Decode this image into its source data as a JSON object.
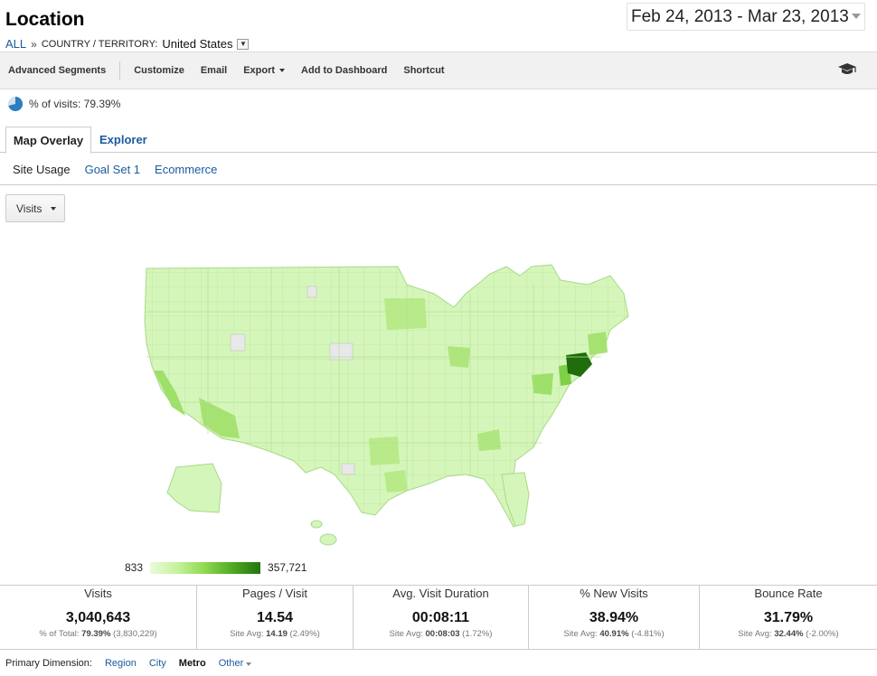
{
  "header": {
    "title": "Location",
    "breadcrumb_all": "ALL",
    "breadcrumb_sep": "»",
    "dimension_label": "COUNTRY / TERRITORY:",
    "dimension_value": "United States",
    "date_range": "Feb 24, 2013 - Mar 23, 2013"
  },
  "toolbar": {
    "items": [
      "Advanced Segments",
      "Customize",
      "Email",
      "Export",
      "Add to Dashboard",
      "Shortcut"
    ],
    "icon": "graduation-cap-icon"
  },
  "visits_pct": "% of visits: 79.39%",
  "tabs": {
    "active": "Map Overlay",
    "other": "Explorer"
  },
  "subtabs": [
    "Site Usage",
    "Goal Set 1",
    "Ecommerce"
  ],
  "metric_select": "Visits",
  "map_legend": {
    "min": "833",
    "max": "357,721",
    "colors": [
      "#e8fbd9",
      "#c5f39c",
      "#8ed84e",
      "#4fa923",
      "#237410"
    ]
  },
  "stats": [
    {
      "label": "Visits",
      "value": "3,040,643",
      "sub_prefix": "% of Total: ",
      "sub_bold": "79.39%",
      "sub_rest": " (3,830,229)"
    },
    {
      "label": "Pages / Visit",
      "value": "14.54",
      "sub_prefix": "Site Avg: ",
      "sub_bold": "14.19",
      "sub_rest": " (2.49%)"
    },
    {
      "label": "Avg. Visit Duration",
      "value": "00:08:11",
      "sub_prefix": "Site Avg: ",
      "sub_bold": "00:08:03",
      "sub_rest": " (1.72%)"
    },
    {
      "label": "% New Visits",
      "value": "38.94%",
      "sub_prefix": "Site Avg: ",
      "sub_bold": "40.91%",
      "sub_rest": " (-4.81%)"
    },
    {
      "label": "Bounce Rate",
      "value": "31.79%",
      "sub_prefix": "Site Avg: ",
      "sub_bold": "32.44%",
      "sub_rest": " (-2.00%)"
    }
  ],
  "primary_dimension": {
    "label": "Primary Dimension:",
    "options": [
      "Region",
      "City",
      "Metro",
      "Other"
    ],
    "selected": "Metro"
  }
}
